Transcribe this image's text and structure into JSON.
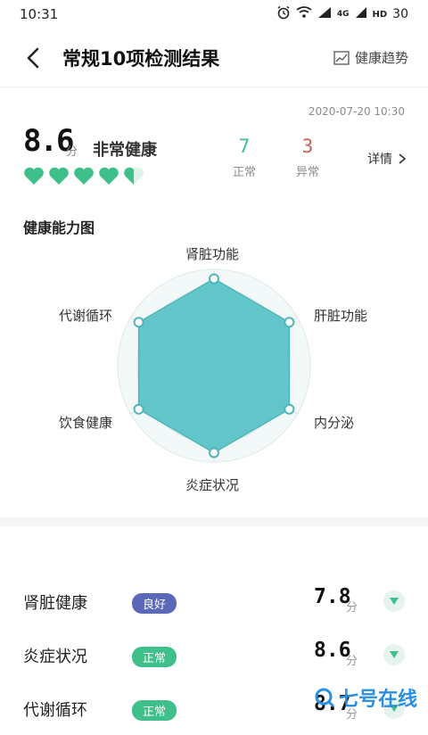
{
  "status_bar": {
    "time": "10:31",
    "battery": "30",
    "network": "4G",
    "hd": "HD",
    "icons": [
      "alarm-icon",
      "wifi-icon",
      "signal-icon",
      "signal-icon",
      "battery-icon"
    ]
  },
  "header": {
    "title": "常规10项检测结果",
    "trend_label": "健康趋势"
  },
  "summary": {
    "datetime": "2020-07-20 10:30",
    "score": "8.6",
    "score_unit": "分",
    "level": "非常健康",
    "hearts_filled": 4.5,
    "hearts_total": 5,
    "normal_count": "7",
    "normal_label": "正常",
    "abnormal_count": "3",
    "abnormal_label": "异常",
    "details_label": "详情"
  },
  "radar": {
    "title": "健康能力图",
    "labels": [
      "肾脏功能",
      "肝脏功能",
      "内分泌",
      "炎症状况",
      "饮食健康",
      "代谢循环"
    ],
    "values": [
      0.95,
      0.95,
      0.95,
      0.95,
      0.95,
      0.95
    ]
  },
  "metrics": [
    {
      "name": "肾脏健康",
      "badge": "良好",
      "badge_color": "#5b68b8",
      "score": "7.8",
      "unit": "分"
    },
    {
      "name": "炎症状况",
      "badge": "正常",
      "badge_color": "#3fbf8a",
      "score": "8.6",
      "unit": "分"
    },
    {
      "name": "代谢循环",
      "badge": "正常",
      "badge_color": "#3fbf8a",
      "score": "8.7",
      "unit": "分"
    }
  ],
  "watermark": "七号在线",
  "colors": {
    "accent_green": "#3fbf8a",
    "abnormal_red": "#c9605a",
    "radar_fill": "#56c1c6",
    "good_badge": "#5b68b8"
  }
}
